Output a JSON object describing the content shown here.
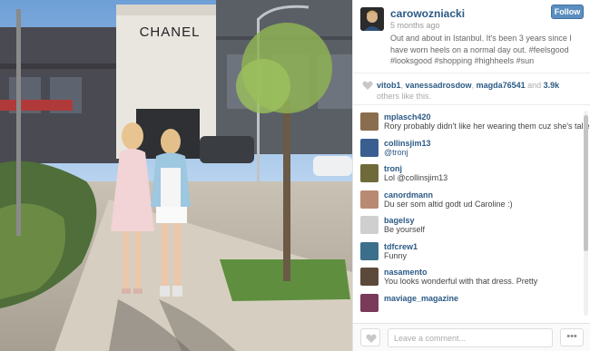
{
  "photo": {
    "storefront_sign": "CHANEL"
  },
  "post": {
    "username": "carowozniacki",
    "time_ago": "5 months ago",
    "follow_label": "Follow",
    "caption": "Out and about in Istanbul. It's been 3 years since I have worn heels on a normal day out. #feelsgood #looksgood #shopping #highheels #sun"
  },
  "likes": {
    "users": [
      "vitob1",
      "vanessadrosdow",
      "magda76541"
    ],
    "separator": ", ",
    "and": " and ",
    "count": "3.9k",
    "suffix": " others like this."
  },
  "comments": [
    {
      "user": "mplasch420",
      "text": "Rory probably didn't like her wearing them cuz she's taller than him already",
      "avatar_color": "#8a6d4e"
    },
    {
      "user": "collinsjim13",
      "text": "@tronj",
      "avatar_color": "#3b5e91"
    },
    {
      "user": "tronj",
      "text": "Lol @collinsjim13",
      "avatar_color": "#6f6a3a"
    },
    {
      "user": "canordmann",
      "text": "Du ser som altid godt ud Caroline :)",
      "avatar_color": "#b88a72"
    },
    {
      "user": "bagelsy",
      "text": "Be yourself",
      "avatar_color": "#cfcfcf"
    },
    {
      "user": "tdfcrew1",
      "text": "Funny",
      "avatar_color": "#3c6f8a"
    },
    {
      "user": "nasamento",
      "text": "You looks wonderful with that dress. Pretty",
      "avatar_color": "#5b4a3c"
    },
    {
      "user": "maviage_magazine",
      "text": "",
      "avatar_color": "#7a3a5a"
    }
  ],
  "footer": {
    "comment_placeholder": "Leave a comment...",
    "more_label": "•••"
  },
  "colors": {
    "link": "#2c5a85",
    "follow_button": "#5a8ebf"
  }
}
